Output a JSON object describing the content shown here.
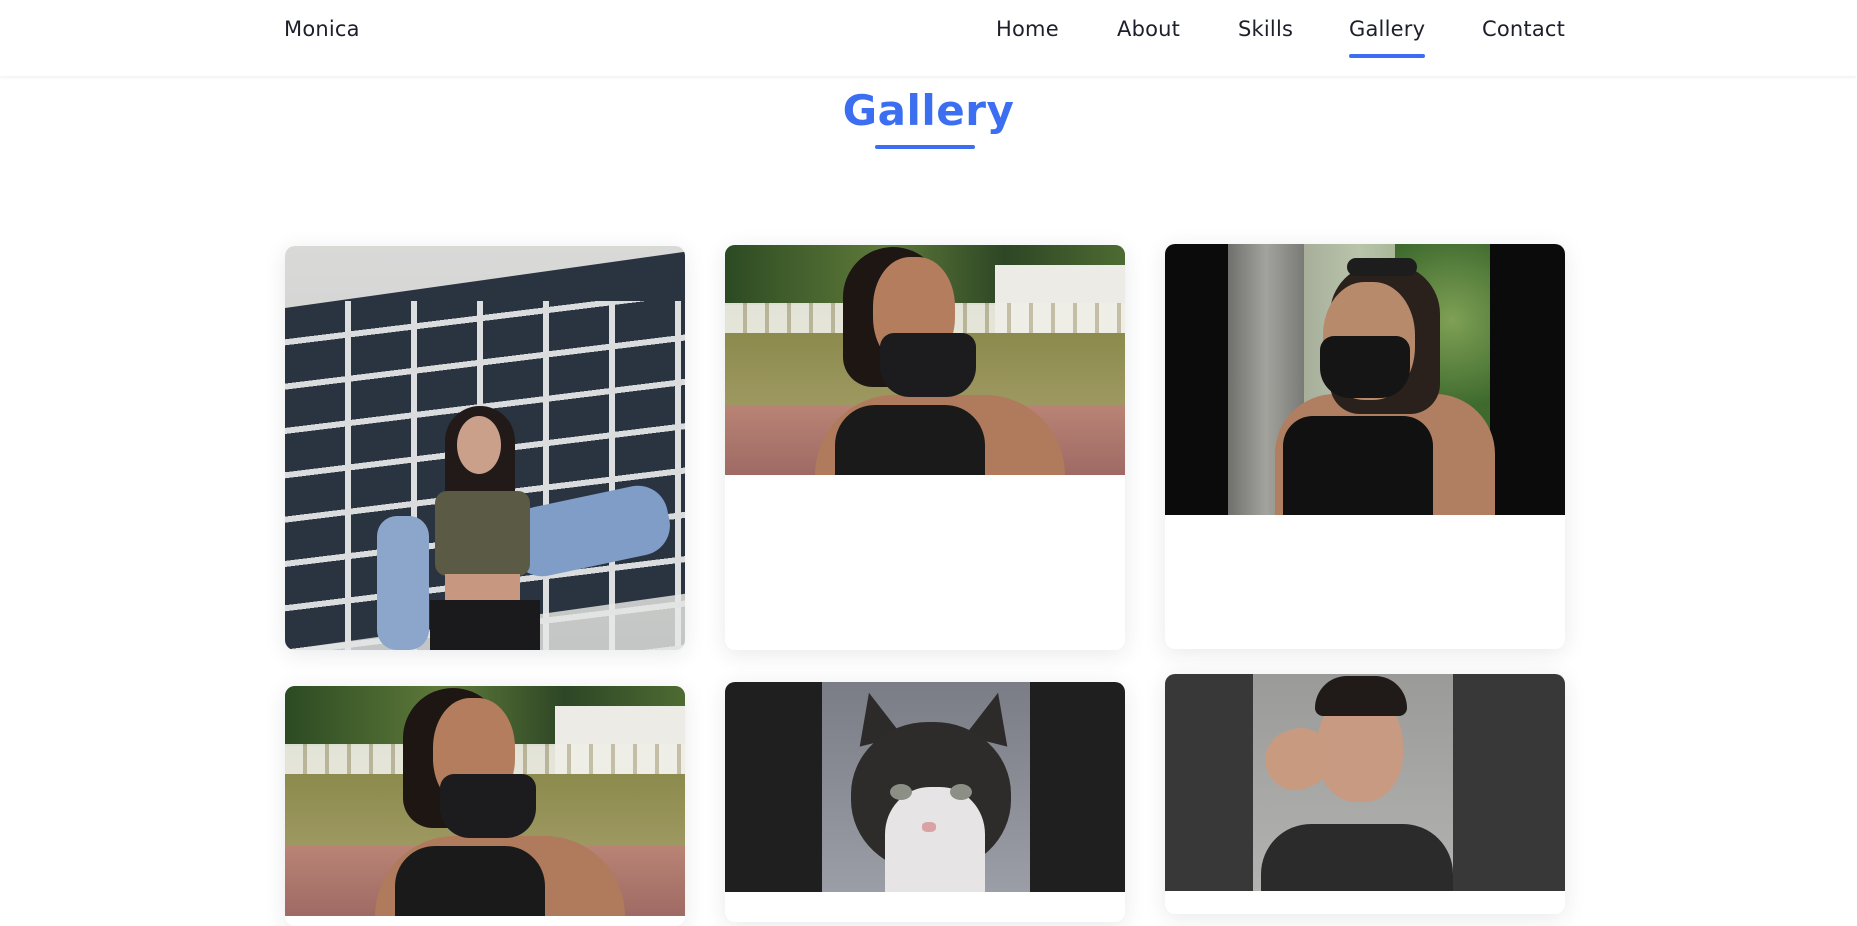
{
  "header": {
    "brand": "Monica",
    "nav": [
      {
        "label": "Home",
        "active": false
      },
      {
        "label": "About",
        "active": false
      },
      {
        "label": "Skills",
        "active": false
      },
      {
        "label": "Gallery",
        "active": true
      },
      {
        "label": "Contact",
        "active": false
      }
    ]
  },
  "section": {
    "title": "Gallery"
  },
  "colors": {
    "accent": "#3b6ef0",
    "text": "#1d1f2b",
    "background": "#ffffff"
  }
}
